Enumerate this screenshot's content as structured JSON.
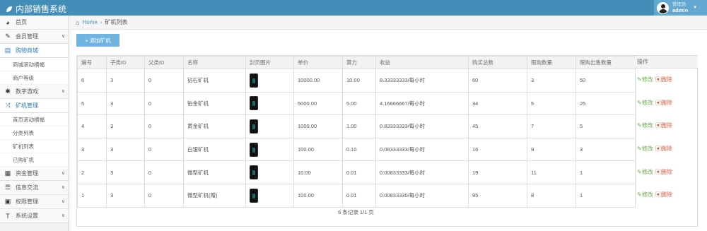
{
  "app": {
    "title": "内部销售系统"
  },
  "user": {
    "role": "管理员",
    "name": "admin"
  },
  "breadcrumb": {
    "home": "Home",
    "current": "矿机列表"
  },
  "sidebar": {
    "items": [
      {
        "label": "首页",
        "icon": "dashboard-icon"
      },
      {
        "label": "会员管理",
        "icon": "edit-icon",
        "arrow": "∨"
      },
      {
        "label": "购物商城",
        "icon": "cart-icon",
        "active": true
      },
      {
        "sub": "商城滚动横幅"
      },
      {
        "sub": "商户等级"
      },
      {
        "label": "数字游戏",
        "icon": "asterisk-icon",
        "arrow": "∨"
      },
      {
        "label": "矿机管理",
        "icon": "shuffle-icon",
        "active": true
      },
      {
        "sub": "首页滚动横幅"
      },
      {
        "sub": "分类列表"
      },
      {
        "sub": "矿机列表"
      },
      {
        "sub": "已购矿机"
      },
      {
        "label": "资金管理",
        "icon": "calendar-icon",
        "arrow": "∨"
      },
      {
        "label": "信息交流",
        "icon": "list-icon",
        "arrow": "∨"
      },
      {
        "label": "权限管理",
        "icon": "picture-icon",
        "arrow": "∨"
      },
      {
        "label": "系统设置",
        "icon": "text-icon",
        "arrow": "∨"
      }
    ]
  },
  "toolbar": {
    "add_label": "添加矿机"
  },
  "table": {
    "headers": [
      "编号",
      "子类ID",
      "父类ID",
      "名称",
      "封页图片",
      "单价",
      "算力",
      "收益",
      "购买总数",
      "限购数量",
      "限购出售数量"
    ],
    "ops_header": "操作",
    "edit_label": "修改",
    "delete_label": "删除",
    "rows": [
      [
        "6",
        "3",
        "0",
        "钻石矿机",
        "",
        "10000.00",
        "10.00",
        "8.33333333/每小时",
        "60",
        "3",
        "50"
      ],
      [
        "5",
        "3",
        "0",
        "铂金矿机",
        "",
        "5000.00",
        "5.00",
        "4.16666667/每小时",
        "34",
        "5",
        "25"
      ],
      [
        "4",
        "3",
        "0",
        "黄金矿机",
        "",
        "1000.00",
        "1.00",
        "0.83333333/每小时",
        "45",
        "7",
        "5"
      ],
      [
        "3",
        "3",
        "0",
        "白银矿机",
        "",
        "100.00",
        "0.10",
        "0.08333333/每小时",
        "16",
        "9",
        "3"
      ],
      [
        "2",
        "3",
        "0",
        "微型矿机",
        "",
        "10.00",
        "0.01",
        "0.00833333/每小时",
        "19",
        "11",
        "1"
      ],
      [
        "1",
        "3",
        "0",
        "微型矿机(赠)",
        "",
        "100.00",
        "0.01",
        "0.00833330/每小时",
        "95",
        "8",
        "1"
      ]
    ],
    "pagination": "6 条记录 1/1 页"
  },
  "colors": {
    "topbar": "#438eb9",
    "accent": "#2b7dbc",
    "edit": "#69aa46",
    "delete": "#dd5a43"
  }
}
